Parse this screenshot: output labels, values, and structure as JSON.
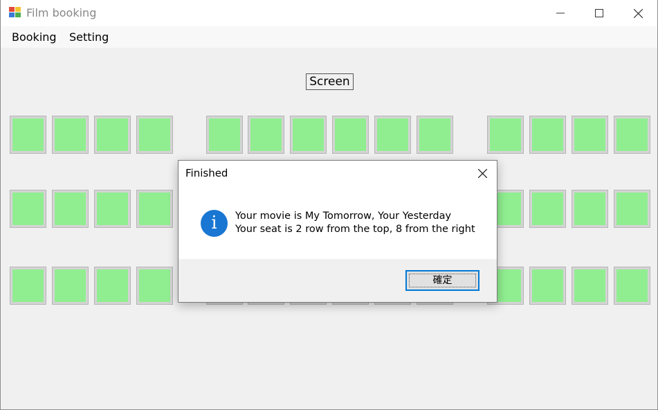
{
  "window": {
    "title": "Film booking"
  },
  "menubar": {
    "items": [
      "Booking",
      "Setting"
    ]
  },
  "screen": {
    "label": "Screen"
  },
  "seat_colors": {
    "available": "#90ee90",
    "frame": "#d4d4d4"
  },
  "dialog": {
    "title": "Finished",
    "icon": "info-icon",
    "line1": "Your movie is My Tomorrow, Your Yesterday",
    "line2": "Your seat is 2 row from the top, 8 from the right",
    "ok_label": "確定",
    "accent": "#0078d7",
    "icon_color": "#1976d2"
  }
}
